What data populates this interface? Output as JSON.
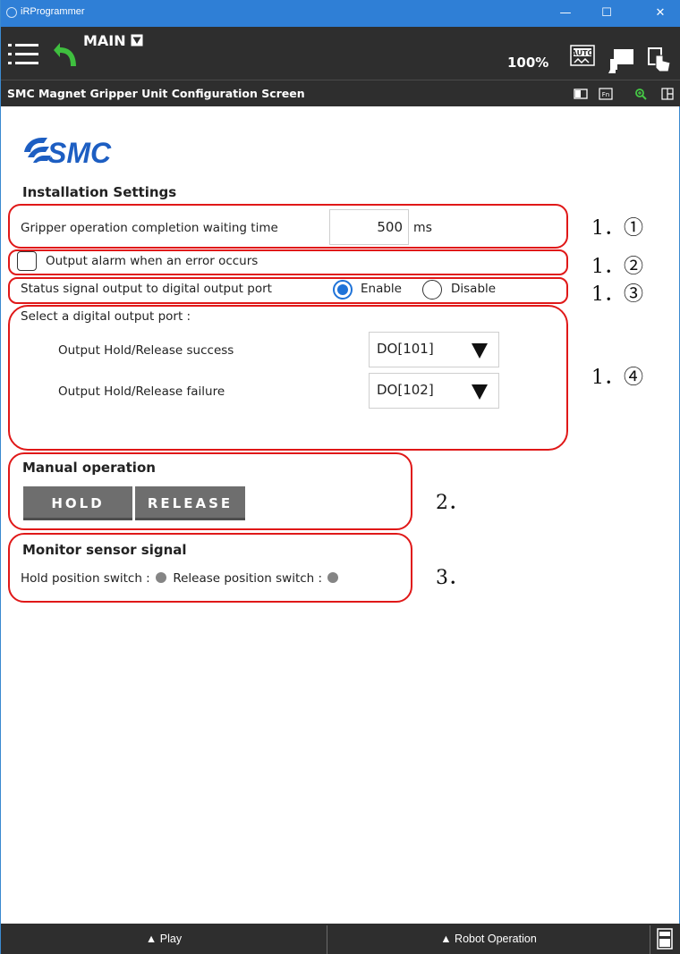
{
  "window": {
    "title": "iRProgrammer",
    "controls": {
      "minimize": "—",
      "maximize": "☐",
      "close": "✕"
    }
  },
  "toolbar": {
    "program_name": "MAIN",
    "zoom": "100%",
    "icons": [
      "menu-icon",
      "back-arrow-icon",
      "program-dropdown-icon",
      "auto-mode-icon",
      "teach-pendant-icon",
      "hand-pointer-icon"
    ]
  },
  "screen": {
    "title": "SMC Magnet Gripper Unit Configuration Screen",
    "icons": [
      "panel-layout-icon",
      "fn-key-icon",
      "zoom-icon",
      "split-view-icon"
    ]
  },
  "logo": {
    "text": "SMC"
  },
  "installation": {
    "title": "Installation Settings",
    "waiting_time_label": "Gripper operation completion waiting time",
    "waiting_time_value": "500",
    "waiting_time_unit": "ms",
    "alarm_label": "Output alarm when an error occurs",
    "alarm_checked": false,
    "status_label": "Status signal output to digital output port",
    "enable_label": "Enable",
    "disable_label": "Disable",
    "status_selected": "Enable",
    "port_title": "Select a digital output port :",
    "success_label": "Output Hold/Release success",
    "success_value": "DO[101]",
    "failure_label": "Output Hold/Release failure",
    "failure_value": "DO[102]"
  },
  "manual": {
    "title": "Manual operation",
    "hold_label": "HOLD",
    "release_label": "RELEASE"
  },
  "monitor": {
    "title": "Monitor sensor signal",
    "hold_label": "Hold position switch :",
    "release_label": "Release position switch :"
  },
  "annotations": {
    "a1": "1．①",
    "a2": "1．②",
    "a3": "1．③",
    "a4": "1．④",
    "a5": "2．",
    "a6": "3．"
  },
  "bottom": {
    "play_label": "▲ Play",
    "robot_label": "▲ Robot Operation"
  },
  "colors": {
    "titlebar": "#2f7fd6",
    "toolbar": "#2e2e2e",
    "accent_radio": "#1f73d8",
    "annotation_red": "#e01818",
    "button_gray": "#6e6e6e"
  }
}
